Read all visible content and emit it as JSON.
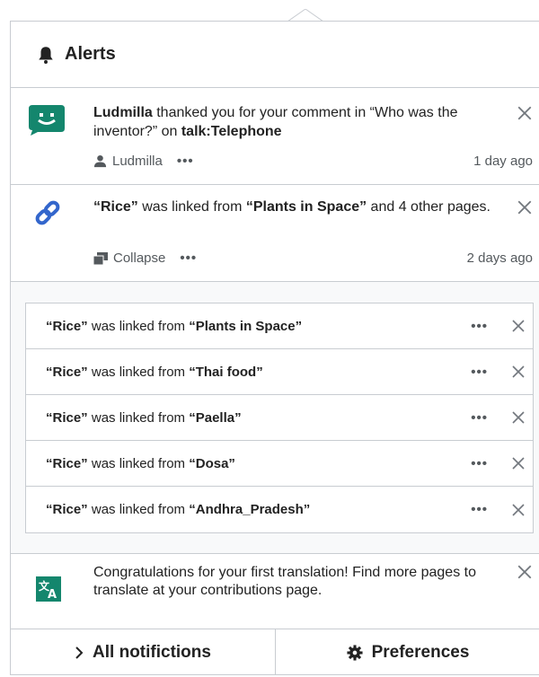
{
  "header": {
    "title": "Alerts",
    "icon": "bell-icon"
  },
  "notifications": [
    {
      "icon": "thanks-icon",
      "icon_color": "#14866d",
      "actor": "Ludmilla",
      "text_mid": " thanked you for your comment in “Who was the inventor?” on ",
      "page": "talk:Telephone",
      "meta_label": "Ludmilla",
      "meta_dots": "•••",
      "time": "1 day ago"
    },
    {
      "icon": "link-icon",
      "icon_color": "#3366cc",
      "subject": "“Rice”",
      "text_mid": " was linked from ",
      "source": "“Plants in Space”",
      "text_end": " and 4 other pages.",
      "meta_label": "Collapse",
      "meta_dots": "•••",
      "time": "2 days ago"
    },
    {
      "icon": "translate-icon",
      "icon_color": "#14866d",
      "text": "Congratulations for your first translation! Find more pages to translate at your contributions page."
    }
  ],
  "bundle": {
    "items": [
      {
        "subject": "“Rice”",
        "mid": " was linked from ",
        "source": "“Plants in Space”",
        "dots": "•••"
      },
      {
        "subject": "“Rice”",
        "mid": " was linked from ",
        "source": "“Thai food”",
        "dots": "•••"
      },
      {
        "subject": "“Rice”",
        "mid": " was linked from ",
        "source": "“Paella”",
        "dots": "•••"
      },
      {
        "subject": "“Rice”",
        "mid": " was linked from ",
        "source": "“Dosa”",
        "dots": "•••"
      },
      {
        "subject": "“Rice”",
        "mid": " was linked from ",
        "source": "“Andhra_Pradesh”",
        "dots": "•••"
      }
    ]
  },
  "footer": {
    "all_label": "All notifictions",
    "prefs_label": "Preferences"
  },
  "colors": {
    "border": "#c8ccd1",
    "muted": "#54595d",
    "text": "#222222",
    "accent_green": "#14866d",
    "accent_blue": "#3366cc"
  }
}
